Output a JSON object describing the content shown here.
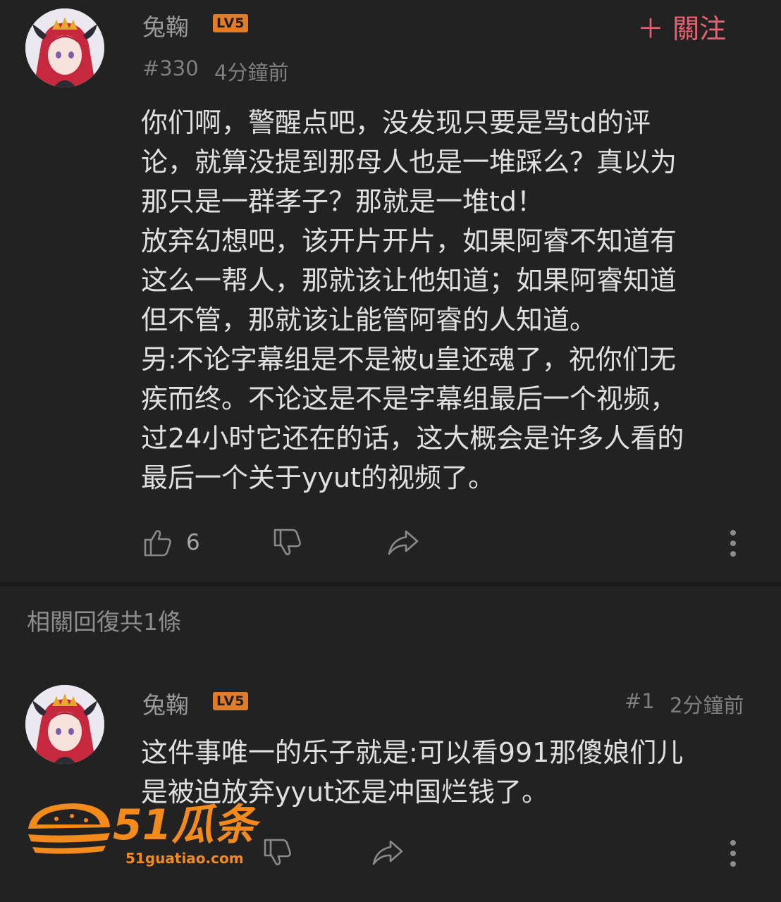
{
  "comment": {
    "username": "兔鞠",
    "level": "LV5",
    "follow_label": "＋ 關注",
    "number": "#330",
    "time": "4分鐘前",
    "text": "你们啊，警醒点吧，没发现只要是骂td的评\n论，就算没提到那母人也是一堆踩么？真以为\n那只是一群孝子？那就是一堆td！\n放弃幻想吧，该开片开片，如果阿睿不知道有\n这么一帮人，那就该让他知道；如果阿睿知道\n但不管，那就该让能管阿睿的人知道。\n另:不论字幕组是不是被u皇还魂了，祝你们无\n疾而终。不论这是不是字幕组最后一个视频，\n过24小时它还在的话，这大概会是许多人看的\n最后一个关于yyut的视频了。",
    "like_count": "6"
  },
  "replies_header": "相關回復共1條",
  "reply": {
    "username": "兔鞠",
    "level": "LV5",
    "number": "#1",
    "time": "2分鐘前",
    "text": "这件事唯一的乐子就是:可以看991那傻娘们儿\n是被迫放弃yyut还是冲国烂钱了。"
  },
  "watermark": {
    "brand": "51瓜条",
    "url": "51guatiao.com"
  },
  "colors": {
    "background": "#222222",
    "follow": "#e8636f",
    "level_badge": "#e07d2a",
    "watermark": "#f28a1c"
  },
  "icons": [
    "thumbs-up-icon",
    "thumbs-down-icon",
    "share-icon",
    "more-vertical-icon"
  ]
}
